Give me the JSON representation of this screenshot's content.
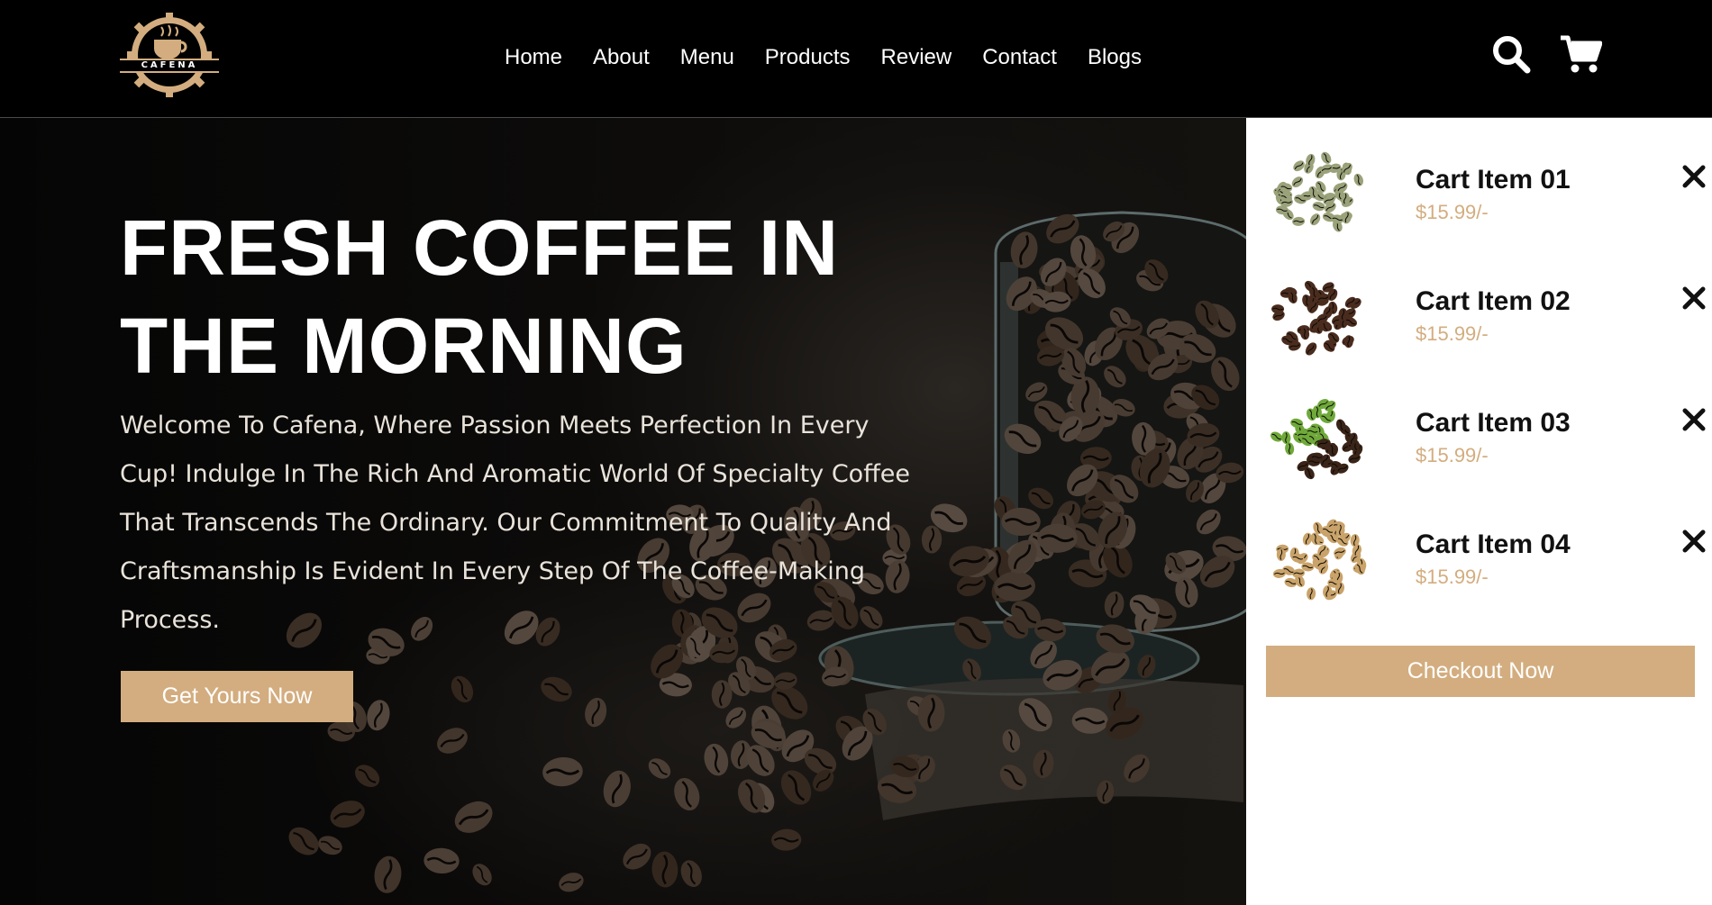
{
  "brand": {
    "logo_text": "CAFENA"
  },
  "nav": {
    "items": [
      "Home",
      "About",
      "Menu",
      "Products",
      "Review",
      "Contact",
      "Blogs"
    ]
  },
  "header_icons": {
    "search": "search-icon",
    "cart": "shopping-cart-icon"
  },
  "hero": {
    "title_line1": "FRESH COFFEE IN",
    "title_line2": "THE MORNING",
    "text": "Welcome To Cafena, Where Passion Meets Perfection In Every Cup! Indulge In The Rich And Aromatic World Of Specialty Coffee That Transcends The Ordinary. Our Commitment To Quality And Craftsmanship Is Evident In Every Step Of The Coffee-Making Process.",
    "cta_label": "Get Yours Now"
  },
  "cart": {
    "items": [
      {
        "name": "Cart Item 01",
        "price": "$15.99/-",
        "bean_color": "#9aa27a"
      },
      {
        "name": "Cart Item 02",
        "price": "$15.99/-",
        "bean_color": "#4a2c1e"
      },
      {
        "name": "Cart Item 03",
        "price": "$15.99/-",
        "bean_color": "#6fa93a"
      },
      {
        "name": "Cart Item 04",
        "price": "$15.99/-",
        "bean_color": "#c9a36a"
      }
    ],
    "checkout_label": "Checkout Now"
  },
  "colors": {
    "accent": "#d3ad7f",
    "background": "#000000",
    "panel": "#ffffff"
  }
}
